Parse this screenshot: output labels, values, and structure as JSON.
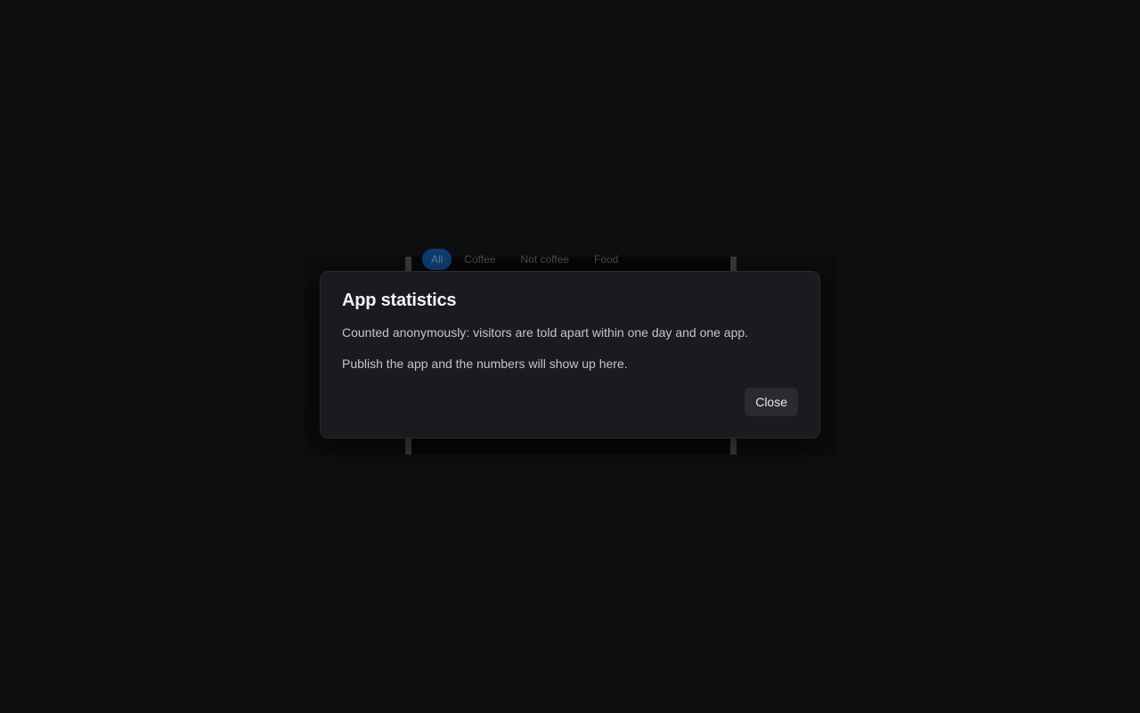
{
  "background_app": {
    "filter_chips": [
      "All",
      "Coffee",
      "Not coffee",
      "Food"
    ]
  },
  "modal": {
    "title": "App statistics",
    "paragraph_1": "Counted anonymously: visitors are told apart within one day and one app.",
    "paragraph_2": "Publish the app and the numbers will show up here.",
    "close_label": "Close"
  },
  "colors": {
    "page_background": "#0e0f11",
    "modal_background": "#1a1b1e",
    "active_chip": "#0f3e73",
    "button_background": "#2a2b2f"
  }
}
